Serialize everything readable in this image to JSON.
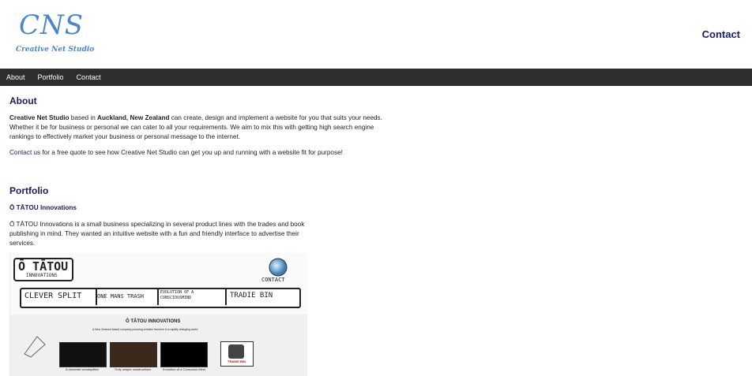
{
  "header": {
    "logo_text": "CNS",
    "logo_subtitle": "Creative Net Studio",
    "contact_label": "Contact"
  },
  "nav": {
    "items": [
      {
        "label": "About"
      },
      {
        "label": "Portfolio"
      },
      {
        "label": "Contact"
      }
    ]
  },
  "about": {
    "title": "About",
    "p1_strong1": "Creative Net Studio",
    "p1_text1": " based in ",
    "p1_strong2": "Auckland, New Zealand",
    "p1_text2": " can create, design and implement a website for you that suits your needs. Whether it be for business or personal we can cater to all your requirements. We aim to mix this with getting high search engine rankings to effectively market your business or personal message to the internet.",
    "p2_link": "Contact us",
    "p2_text": " for a free quote to see how Creative Net Studio can get you up and running with a website fit for purpose!"
  },
  "portfolio": {
    "title": "Portfolio",
    "project_title": "Ō TĀTOU Innovations",
    "project_desc": "Ō TĀTOU Innovations is a small business specializing in several product lines with the trades and book publishing in mind. They wanted an intuitive website with a fun and friendly interface to advertise their services.",
    "screenshot": {
      "logo": "Ō TĀTOU",
      "logo_sub": "INNOVATIONS",
      "contact": "CONTACT",
      "tabs": [
        "CLEVER SPLIT",
        "ONE MANS TRASH",
        "EVOLUTION OF A CONSCIOUSMIND",
        "TRADIE BIN"
      ],
      "heading": "Ō TĀTOU INNOVATIONS",
      "tagline": "A New Zealand based company pursuing creative freedom in a rapidly changing world",
      "card_captions": [
        "A domestic woodsplitter",
        "Truly unique constructions",
        "Evolution of a Conscious Mind",
        "TRADIE BIN"
      ]
    }
  }
}
